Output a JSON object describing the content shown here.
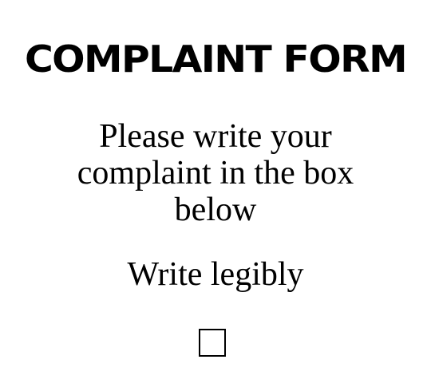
{
  "form": {
    "title": "COMPLAINT FORM",
    "instruction": "Please write your complaint in the box below",
    "note": "Write legibly",
    "complaint_box": {
      "value": "",
      "placeholder": ""
    }
  }
}
